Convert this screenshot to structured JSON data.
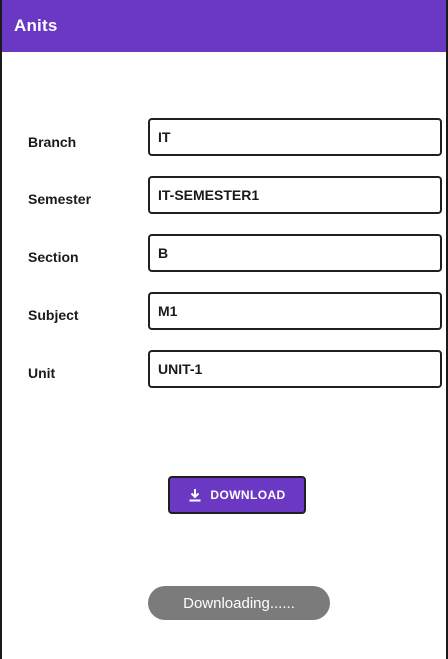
{
  "app_bar": {
    "title": "Anits",
    "color": "#6a38c2"
  },
  "form": {
    "branch": {
      "label": "Branch",
      "value": "IT"
    },
    "semester": {
      "label": "Semester",
      "value": "IT-SEMESTER1"
    },
    "section": {
      "label": "Section",
      "value": "B"
    },
    "subject": {
      "label": "Subject",
      "value": "M1"
    },
    "unit": {
      "label": "Unit",
      "value": "UNIT-1"
    }
  },
  "download_button": {
    "label": "DOWNLOAD",
    "icon": "download-icon"
  },
  "toast": {
    "text": "Downloading......"
  }
}
